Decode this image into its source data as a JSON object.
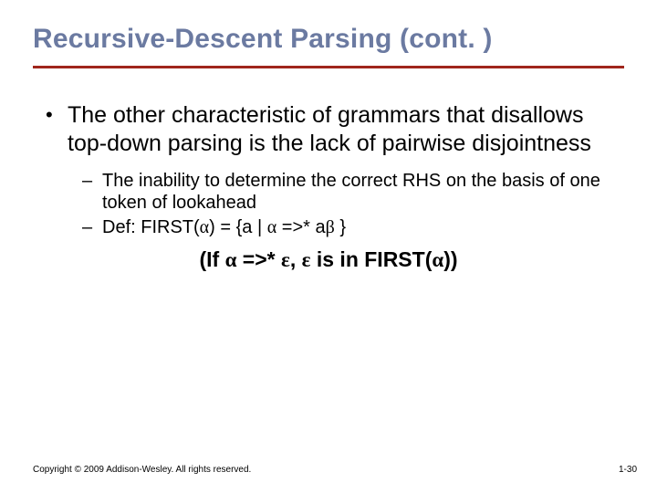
{
  "title": "Recursive-Descent Parsing (cont. )",
  "bullet1": "The other characteristic of grammars that disallows top-down parsing is the lack of pairwise disjointness",
  "sub1": "The inability to determine the correct RHS on the basis of one token of lookahead",
  "sub2_prefix": "Def: FIRST(",
  "sub2_mid1": ") = {a | ",
  "sub2_mid2": " =>* a",
  "sub2_suffix": " }",
  "cen_p1": "(If ",
  "cen_p2": " =>* ",
  "cen_p3": ", ",
  "cen_p4": " is in FIRST(",
  "cen_p5": "))",
  "alpha": "α",
  "beta": "β",
  "epsilon": "ε",
  "footer_left": "Copyright © 2009 Addison-Wesley. All rights reserved.",
  "footer_right": "1-30"
}
